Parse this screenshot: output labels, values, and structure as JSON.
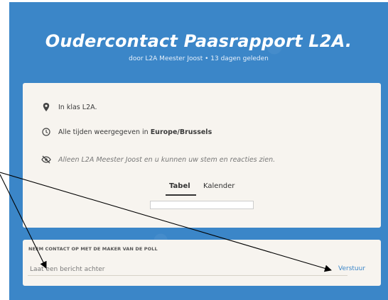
{
  "header": {
    "title": "Oudercontact Paasrapport L2A.",
    "subtitle": "door L2A Meester Joost • 13 dagen geleden"
  },
  "info": {
    "location": "In klas L2A.",
    "timezone_prefix": "Alle tijden weergegeven in",
    "timezone_value": "Europe/Brussels",
    "visibility": "Alleen L2A Meester Joost en u kunnen uw stem en reacties zien."
  },
  "icons": {
    "location": "location-pin-icon",
    "clock": "clock-icon",
    "visibility": "eye-off-icon"
  },
  "tabs": [
    {
      "label": "Tabel",
      "active": true
    },
    {
      "label": "Kalender",
      "active": false
    }
  ],
  "contact": {
    "heading": "NEEM CONTACT OP MET DE MAKER VAN DE POLL",
    "placeholder": "Laat een bericht achter",
    "send_label": "Verstuur"
  },
  "colors": {
    "background": "#3b86c8",
    "card": "#f7f4ef",
    "accent": "#3b86c8"
  }
}
